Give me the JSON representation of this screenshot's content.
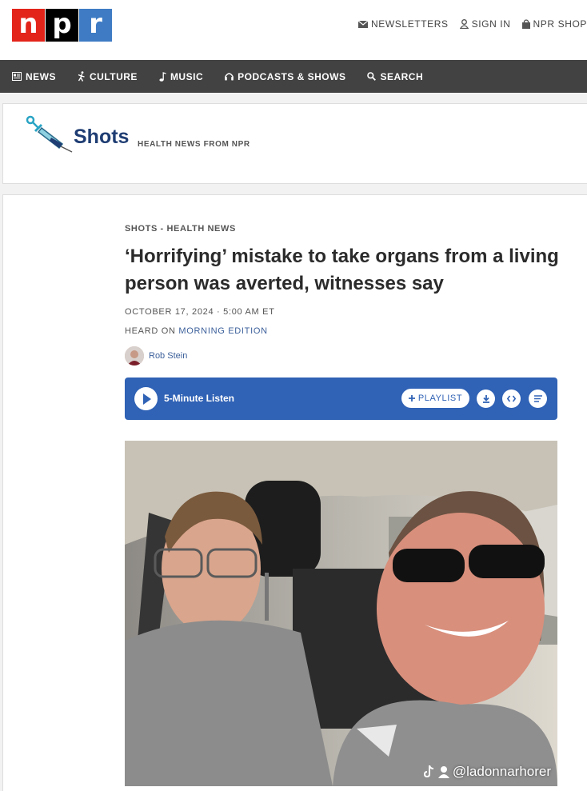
{
  "logo": {
    "letters": [
      "n",
      "p",
      "r"
    ],
    "colors": [
      "#e3241b",
      "#000000",
      "#3e7bc4"
    ]
  },
  "utility": {
    "newsletters": "NEWSLETTERS",
    "sign_in": "SIGN IN",
    "shop": "NPR SHOP"
  },
  "nav": {
    "items": [
      {
        "label": "NEWS",
        "icon": "news-icon"
      },
      {
        "label": "CULTURE",
        "icon": "culture-icon"
      },
      {
        "label": "MUSIC",
        "icon": "music-note-icon"
      },
      {
        "label": "PODCASTS & SHOWS",
        "icon": "headphones-icon"
      },
      {
        "label": "SEARCH",
        "icon": "search-icon"
      }
    ]
  },
  "section": {
    "name": "Shots",
    "tagline": "HEALTH NEWS FROM NPR"
  },
  "article": {
    "kicker_section": "SHOTS - HEALTH NEWS",
    "headline": "‘Horrifying’ mistake to take organs from a living person was averted, witnesses say",
    "date": "OCTOBER 17, 2024 · 5:00 AM ET",
    "heard_on_prefix": "HEARD ON ",
    "heard_on_program": "MORNING EDITION",
    "author": "Rob Stein"
  },
  "audio": {
    "listen_label": "5-Minute Listen",
    "playlist_label": "PLAYLIST",
    "accent": "#3062b5"
  },
  "photo": {
    "watermark": "@ladonnarhorer"
  }
}
